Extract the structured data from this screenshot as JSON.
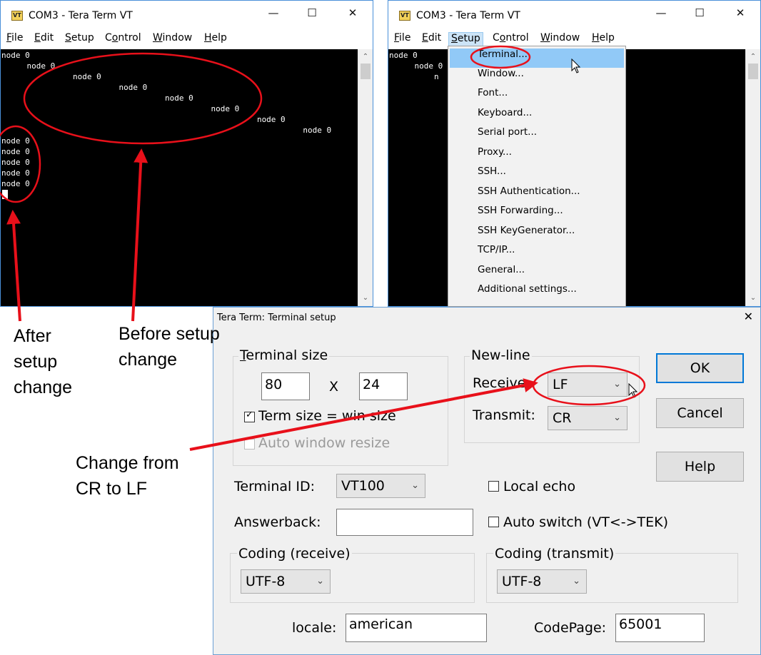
{
  "left_window": {
    "title": "COM3 - Tera Term VT",
    "logo_text": "VT",
    "menu": [
      "File",
      "Edit",
      "Setup",
      "Control",
      "Window",
      "Help"
    ],
    "terminal_lines": [
      "node 0",
      "    node 0",
      "        node 0",
      "            node 0",
      "                node 0",
      "                    node 0",
      "                        node 0",
      "                            node 0",
      "node 0",
      "node 0",
      "node 0",
      "node 0",
      "node 0"
    ]
  },
  "right_window": {
    "title": "COM3 - Tera Term VT",
    "logo_text": "VT",
    "menu": [
      "File",
      "Edit",
      "Setup",
      "Control",
      "Window",
      "Help"
    ],
    "terminal_lines": [
      "node 0",
      "    node 0",
      "        n"
    ],
    "setup_menu_items": [
      "Terminal...",
      "Window...",
      "Font...",
      "Keyboard...",
      "Serial port...",
      "Proxy...",
      "SSH...",
      "SSH Authentication...",
      "SSH Forwarding...",
      "SSH KeyGenerator...",
      "TCP/IP...",
      "General...",
      "Additional settings..."
    ]
  },
  "dialog": {
    "title": "Tera Term: Terminal setup",
    "terminal_size": {
      "label_u": "T",
      "label_rest": "erminal size",
      "width": "80",
      "x_sep": "X",
      "height": "24",
      "term_size_win_size": "Term size = win size",
      "term_size_checked": true,
      "auto_window_resize": "Auto window resize",
      "auto_window_resize_checked": false
    },
    "new_line": {
      "label": "New-line",
      "receive_label": "Receive:",
      "receive_value": "LF",
      "transmit_label": "Transmit:",
      "transmit_value": "CR"
    },
    "buttons": {
      "ok": "OK",
      "cancel": "Cancel",
      "help": "Help"
    },
    "terminal_id_label": "Terminal ID:",
    "terminal_id_value": "VT100",
    "answerback_label": "Answerback:",
    "answerback_value": "",
    "local_echo": "Local echo",
    "local_echo_checked": false,
    "auto_switch": "Auto switch (VT<->TEK)",
    "auto_switch_checked": false,
    "coding_receive_label": "Coding (receive)",
    "coding_receive_value": "UTF-8",
    "coding_transmit_label": "Coding (transmit)",
    "coding_transmit_value": "UTF-8",
    "locale_label": "locale:",
    "locale_value": "american",
    "codepage_label": "CodePage:",
    "codepage_value": "65001"
  },
  "annotations": {
    "after_lines": [
      "After",
      "setup",
      "change"
    ],
    "before_lines": [
      "Before setup",
      "change"
    ],
    "change_lines": [
      "Change from",
      "CR to LF"
    ],
    "color": "#e8101a"
  }
}
